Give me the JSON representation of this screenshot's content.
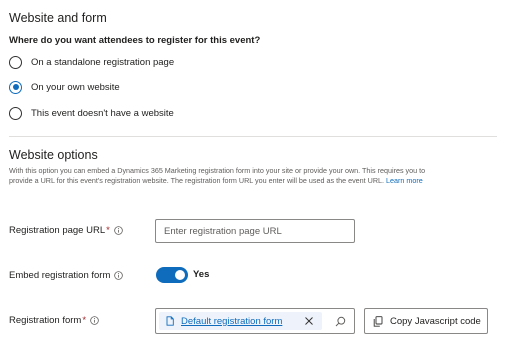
{
  "website_and_form": {
    "title": "Website and form",
    "question": "Where do you want attendees to register for this event?",
    "options": [
      {
        "label": "On a standalone registration page",
        "selected": false
      },
      {
        "label": "On your own website",
        "selected": true
      },
      {
        "label": "This event doesn't have a website",
        "selected": false
      }
    ]
  },
  "website_options": {
    "title": "Website options",
    "description": "With this option you can embed a Dynamics 365 Marketing registration form into your site or provide your own. This requires you to provide a URL for this event's registration website. The registration form URL you enter will be used as the event URL.",
    "learn_more": "Learn more",
    "registration_url": {
      "label": "Registration page URL",
      "required_mark": "*",
      "value": "",
      "placeholder": "Enter registration page URL"
    },
    "embed_form": {
      "label": "Embed registration form",
      "state": "Yes",
      "on": true
    },
    "registration_form": {
      "label": "Registration form",
      "required_mark": "*",
      "value": "Default registration form"
    },
    "copy_button": "Copy Javascript code"
  },
  "icons": {
    "info": "info-icon",
    "form": "form-icon",
    "close": "close-icon",
    "search": "search-icon",
    "copy": "copy-icon"
  },
  "colors": {
    "accent": "#0f6cbd",
    "required": "#a4262c",
    "chip_background": "#eef3fb"
  }
}
